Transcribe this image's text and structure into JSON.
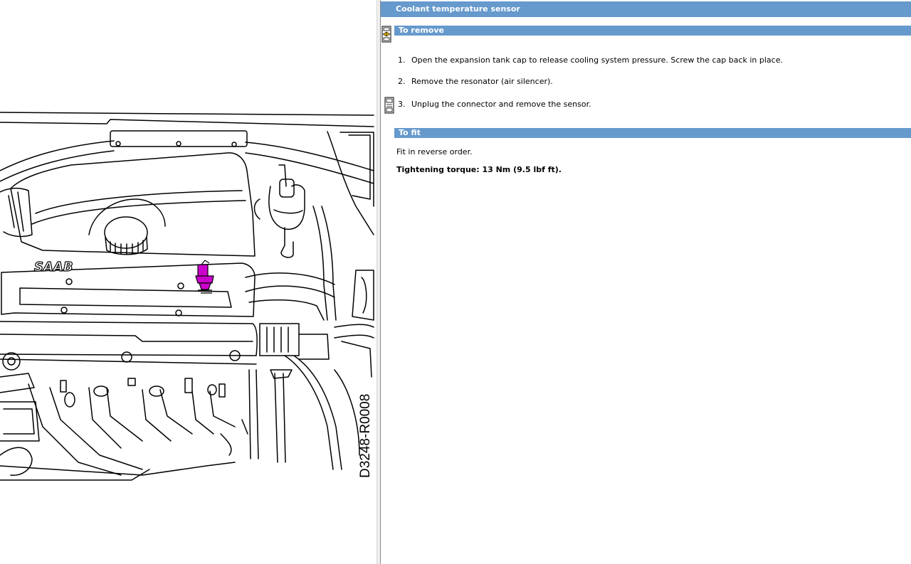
{
  "window": {
    "title": "Coolant temperature sensor"
  },
  "sections": {
    "remove": {
      "heading": "To remove",
      "steps": [
        {
          "num": "1.",
          "text": "Open the expansion tank cap to release cooling system pressure. Screw the cap back in place."
        },
        {
          "num": "2.",
          "text": "Remove the resonator (air silencer)."
        },
        {
          "num": "3.",
          "text": "Unplug the connector and remove the sensor."
        }
      ]
    },
    "fit": {
      "heading": "To fit",
      "text": "Fit in reverse order.",
      "torque": "Tightening torque: 13 Nm (9.5 lbf ft)."
    }
  },
  "illustration": {
    "figure_code": "D3248-R0008",
    "brand_label": "SAAB",
    "highlight_color": "#cc00cc"
  },
  "colors": {
    "section_bar": "#6699cc",
    "heading_text": "#ffffff"
  },
  "icons": {
    "nav": "back-forward-icon",
    "step": "step-illustration-icon"
  }
}
